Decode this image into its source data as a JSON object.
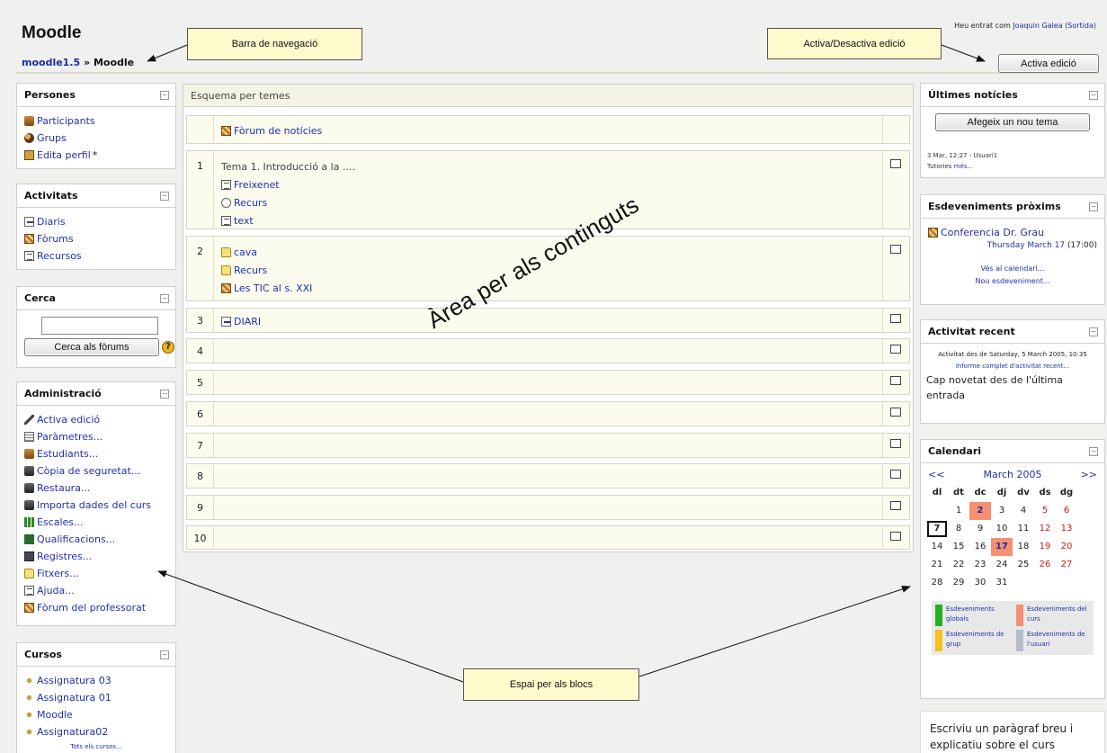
{
  "header": {
    "site_title": "Moodle",
    "breadcrumb_link": "moodle1.5",
    "breadcrumb_sep": " » ",
    "breadcrumb_current": "Moodle",
    "login_prefix": "Heu entrat com",
    "login_user": "Joaquin Galea",
    "login_logout": "(Sortida)",
    "edit_button": "Activa edició"
  },
  "callouts": {
    "navbar": "Barra de navegació",
    "toggle_edit": "Activa/Desactiva edició",
    "content_area": "Àrea per als continguts",
    "blocks_space": "Espai per als blocs"
  },
  "left_blocks": {
    "people": {
      "title": "Persones",
      "items": [
        {
          "label": "Participants",
          "icon": "participants-icon"
        },
        {
          "label": "Grups",
          "icon": "groups-icon"
        },
        {
          "label": "Edita perfil",
          "icon": "edit-profile-icon"
        }
      ],
      "required_mark": "*"
    },
    "activities": {
      "title": "Activitats",
      "items": [
        {
          "label": "Diaris",
          "icon": "journal-icon"
        },
        {
          "label": "Fòrums",
          "icon": "forum-icon"
        },
        {
          "label": "Recursos",
          "icon": "resource-icon"
        }
      ]
    },
    "search": {
      "title": "Cerca",
      "input_value": "",
      "button": "Cerca als fòrums",
      "help": "?"
    },
    "admin": {
      "title": "Administració",
      "items": [
        {
          "label": "Activa edició",
          "icon": "edit-pen-icon"
        },
        {
          "label": "Paràmetres...",
          "icon": "settings-icon"
        },
        {
          "label": "Estudiants...",
          "icon": "students-icon"
        },
        {
          "label": "Còpia de seguretat...",
          "icon": "backup-icon"
        },
        {
          "label": "Restaura...",
          "icon": "restore-icon"
        },
        {
          "label": "Importa dades del curs",
          "icon": "import-icon"
        },
        {
          "label": "Escales...",
          "icon": "scales-icon"
        },
        {
          "label": "Qualificacions...",
          "icon": "grades-icon"
        },
        {
          "label": "Registres...",
          "icon": "logs-icon"
        },
        {
          "label": "Fitxers...",
          "icon": "files-icon"
        },
        {
          "label": "Ajuda...",
          "icon": "help-doc-icon"
        },
        {
          "label": "Fòrum del professorat",
          "icon": "teacher-forum-icon"
        }
      ]
    },
    "courses": {
      "title": "Cursos",
      "items": [
        {
          "label": "Assignatura 03"
        },
        {
          "label": "Assignatura 01"
        },
        {
          "label": "Moodle"
        },
        {
          "label": "Assignatura02"
        }
      ],
      "all_courses": "Tots els cursos..."
    }
  },
  "center": {
    "header": "Esquema per temes",
    "news_forum": "Fòrum de notícies",
    "sections": [
      {
        "num": "1",
        "summary": "Tema 1. Introducció a la ....",
        "items": [
          {
            "label": "Freixenet",
            "icon": "doc-icon"
          },
          {
            "label": "Recurs",
            "icon": "resource-icon"
          },
          {
            "label": "text",
            "icon": "doc-icon"
          }
        ]
      },
      {
        "num": "2",
        "summary": "",
        "items": [
          {
            "label": "cava",
            "icon": "folder-icon"
          },
          {
            "label": "Recurs",
            "icon": "folder-icon"
          },
          {
            "label": "Les TIC al s. XXI",
            "icon": "forum-icon"
          }
        ]
      },
      {
        "num": "3",
        "summary": "",
        "items": [
          {
            "label": "DIARI",
            "icon": "journal-icon"
          }
        ]
      },
      {
        "num": "4"
      },
      {
        "num": "5"
      },
      {
        "num": "6"
      },
      {
        "num": "7"
      },
      {
        "num": "8"
      },
      {
        "num": "9"
      },
      {
        "num": "10"
      }
    ]
  },
  "right_blocks": {
    "news": {
      "title": "Últimes notícies",
      "button": "Afegeix un nou tema",
      "entry_meta": "3 Mar, 12:27 - Usuari1",
      "entry_title": "Tutories",
      "more": "més..."
    },
    "upcoming": {
      "title": "Esdeveniments pròxims",
      "event": "Conferencia Dr. Grau",
      "event_date": "Thursday March 17",
      "event_time": "(17:00)",
      "go_calendar": "Vés al calendari...",
      "new_event": "Nou esdeveniment..."
    },
    "recent": {
      "title": "Activitat recent",
      "since": "Activitat des de Saturday, 5 March 2005, 10:35",
      "full_report": "Informe complet d'activitat recent...",
      "nothing": "Cap novetat des de l'última entrada"
    },
    "calendar": {
      "title": "Calendari",
      "prev": "<<",
      "month": "March 2005",
      "next": ">>",
      "weekdays": [
        "dl",
        "dt",
        "dc",
        "dj",
        "dv",
        "ds",
        "dg"
      ],
      "weeks": [
        [
          "",
          "1",
          "2",
          "3",
          "4",
          "5",
          "6"
        ],
        [
          "7",
          "8",
          "9",
          "10",
          "11",
          "12",
          "13"
        ],
        [
          "14",
          "15",
          "16",
          "17",
          "18",
          "19",
          "20"
        ],
        [
          "21",
          "22",
          "23",
          "24",
          "25",
          "26",
          "27"
        ],
        [
          "28",
          "29",
          "30",
          "31",
          "",
          "",
          ""
        ]
      ],
      "event_days": [
        "2",
        "17"
      ],
      "today": "7",
      "legend": [
        {
          "label": "Esdeveniments globals",
          "color": "#22b022"
        },
        {
          "label": "Esdeveniments del curs",
          "color": "#f59070"
        },
        {
          "label": "Esdeveniments de grup",
          "color": "#f5c020"
        },
        {
          "label": "Esdeveniments de l'usuari",
          "color": "#b4bcc8"
        }
      ]
    },
    "summary_text": "Escriviu un paràgraf breu i explicatiu sobre el curs"
  },
  "colors": {
    "link": "#2030b0",
    "section_bg": "#fbfbee",
    "callout_bg": "#fffbcc",
    "event_day": "#f59070",
    "weekend": "#d01818"
  }
}
